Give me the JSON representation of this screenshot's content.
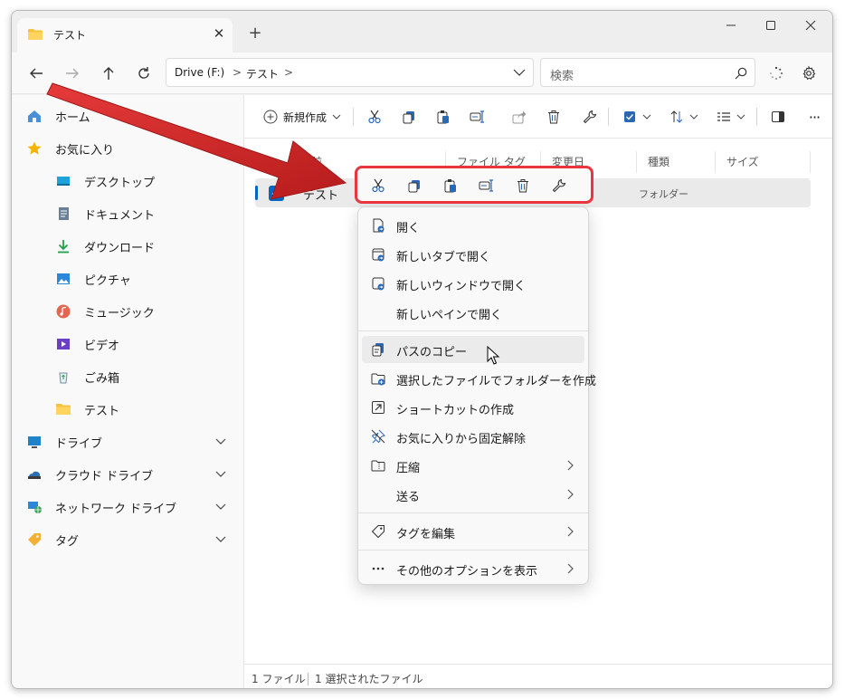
{
  "window": {
    "tab_title": "テスト",
    "tab_close": "✕",
    "tab_new": "+"
  },
  "address": {
    "crumbs": [
      "Drive (F:)",
      "テスト"
    ],
    "search_placeholder": "検索"
  },
  "toolbar": {
    "new_label": "新規作成",
    "more": "···"
  },
  "sidebar": {
    "items": [
      {
        "label": "ホーム",
        "icon": "home-icon"
      },
      {
        "label": "お気に入り",
        "icon": "star-icon"
      },
      {
        "label": "デスクトップ",
        "icon": "desktop-icon"
      },
      {
        "label": "ドキュメント",
        "icon": "documents-icon"
      },
      {
        "label": "ダウンロード",
        "icon": "download-icon"
      },
      {
        "label": "ピクチャ",
        "icon": "pictures-icon"
      },
      {
        "label": "ミュージック",
        "icon": "music-icon"
      },
      {
        "label": "ビデオ",
        "icon": "video-icon"
      },
      {
        "label": "ごみ箱",
        "icon": "recycle-bin-icon"
      },
      {
        "label": "テスト",
        "icon": "folder-icon"
      },
      {
        "label": "ドライブ",
        "icon": "drive-icon"
      },
      {
        "label": "クラウド ドライブ",
        "icon": "cloud-drive-icon"
      },
      {
        "label": "ネットワーク ドライブ",
        "icon": "network-drive-icon"
      },
      {
        "label": "タグ",
        "icon": "tag-icon"
      }
    ]
  },
  "columns": {
    "name": "名前",
    "tags": "ファイル タグ",
    "modified": "変更日",
    "type": "種類",
    "size": "サイズ"
  },
  "file": {
    "name": "テスト",
    "type": "フォルダー"
  },
  "status": {
    "count": "1 ファイル",
    "selected": "1 選択されたファイル"
  },
  "menu": {
    "items": [
      {
        "label": "開く",
        "icon": "open-icon"
      },
      {
        "label": "新しいタブで開く",
        "icon": "open-new-tab-icon"
      },
      {
        "label": "新しいウィンドウで開く",
        "icon": "open-new-window-icon"
      },
      {
        "label": "新しいペインで開く",
        "icon": ""
      },
      {
        "label": "パスのコピー",
        "icon": "copy-path-icon"
      },
      {
        "label": "選択したファイルでフォルダーを作成",
        "icon": "new-folder-icon"
      },
      {
        "label": "ショートカットの作成",
        "icon": "shortcut-icon"
      },
      {
        "label": "お気に入りから固定解除",
        "icon": "unpin-icon"
      },
      {
        "label": "圧縮",
        "icon": "zip-icon"
      },
      {
        "label": "送る",
        "icon": ""
      },
      {
        "label": "タグを編集",
        "icon": "tag-icon"
      },
      {
        "label": "その他のオプションを表示",
        "icon": "more-icon"
      }
    ]
  },
  "colors": {
    "accent": "#0067c0",
    "highlight": "#e8353f",
    "folder": "#f5c242"
  }
}
